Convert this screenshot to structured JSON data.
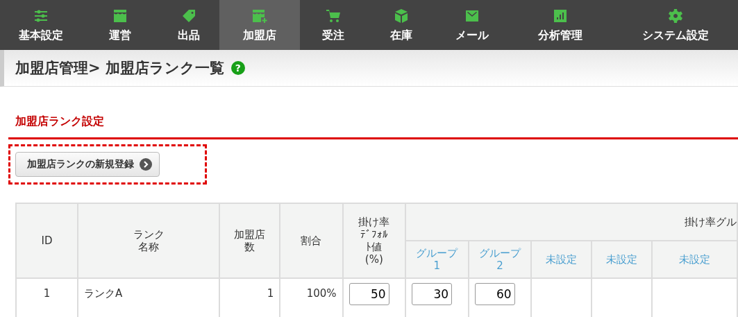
{
  "nav": [
    {
      "label": "基本設定",
      "selected": false
    },
    {
      "label": "運営",
      "selected": false
    },
    {
      "label": "出品",
      "selected": false
    },
    {
      "label": "加盟店",
      "selected": true
    },
    {
      "label": "受注",
      "selected": false
    },
    {
      "label": "在庫",
      "selected": false
    },
    {
      "label": "メール",
      "selected": false
    },
    {
      "label": "分析管理",
      "selected": false
    },
    {
      "label": "システム設定",
      "selected": false
    }
  ],
  "page_title": "加盟店管理> 加盟店ランク一覧",
  "help_mark": "?",
  "section_heading": "加盟店ランク設定",
  "new_button": "加盟店ランクの新規登録",
  "table": {
    "columns": [
      "ID",
      "ランク名称",
      "加盟店数",
      "割合",
      "掛け率ﾃﾞﾌｫﾙﾄ値(%)"
    ],
    "group_header": "掛け率グル",
    "groups": [
      "グループ1",
      "グループ2",
      "未設定",
      "未設定",
      "未設定"
    ],
    "rows": [
      {
        "id": "1",
        "name": "ランクA",
        "count": "1",
        "ratio": "100%",
        "default_rate": "50",
        "group_rates": [
          "30",
          "60"
        ]
      }
    ]
  }
}
